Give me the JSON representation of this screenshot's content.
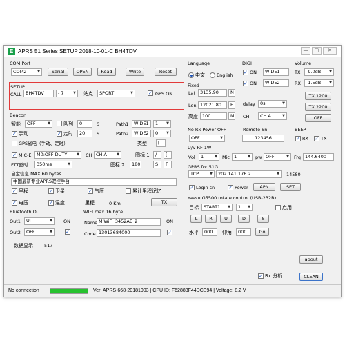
{
  "window": {
    "title": "APRS   51 Series SETUP 2018-10-01-C BH4TDV",
    "logo": "E",
    "minimize": "—",
    "maximize": "▢",
    "close": "✕"
  },
  "com_port": {
    "label": "COM Port",
    "port": "COM2",
    "serial_label": "Serial",
    "open_label": "OPEN",
    "read_label": "Read",
    "write_label": "Write",
    "reset_label": "Reset"
  },
  "setup": {
    "label": "SETUP",
    "call_label": "CALL",
    "call_value": "BH4TDV",
    "ssid": "- 7",
    "station_label": "站点",
    "station_value": "SPORT",
    "gps_on_label": "GPS ON",
    "gps_on_checked": true
  },
  "beacon": {
    "label": "Beacon",
    "smart_label": "智能",
    "smart_value": "OFF",
    "queue_label": "队列",
    "queue_checked": false,
    "queue_value": "0",
    "queue_unit": "S",
    "path1_label": "Path1",
    "path1_value": "WIDE1",
    "path1_n": "1",
    "manual_label": "手动",
    "manual_checked": true,
    "timer_label": "定时",
    "timer_checked": true,
    "timer_value": "20",
    "timer_unit": "S",
    "path2_label": "Path2",
    "path2_value": "WIDE2",
    "path2_n": "0",
    "gps_save_label": "GPS省电（手动、定时）",
    "gps_save_checked": false,
    "type_label": "类型",
    "type_value": "[",
    "mice_label": "MIC-E",
    "mice_checked": true,
    "mice_value": "M0:OFF DUTY",
    "ch_label": "CH",
    "ch_value": "CH A",
    "icon1_label": "图标 1",
    "icon1_a": "/",
    "icon1_b": "[",
    "ftt_label": "FTT延时",
    "ftt_value": "350ms",
    "icon2_label": "图标 2",
    "icon2_val": "180",
    "icon2_a": "S",
    "icon2_b": "F"
  },
  "custom_info": {
    "label": "自定信息 MAX 60 bytes",
    "value": "中国最新专业APRS双控手台"
  },
  "options": {
    "mileage_label": "里程",
    "mileage_checked": true,
    "satellite_label": "卫星",
    "satellite_checked": true,
    "pressure_label": "气压",
    "pressure_checked": true,
    "total_mileage_label": "累计里程记忆",
    "total_mileage_checked": false,
    "voltage_label": "电压",
    "voltage_checked": true,
    "temperature_label": "温度",
    "temperature_checked": true,
    "mileage2_label": "里程",
    "mileage2_value": "0 Km",
    "tx_label": "TX"
  },
  "bluetooth": {
    "label": "Bluetooth OUT",
    "out1_label": "Out1",
    "out1_value": "UI",
    "out1_on": "ON",
    "out2_label": "Out2",
    "out2_value": "OFF",
    "out2_checked": true
  },
  "wifi": {
    "label": "WIFI max 16 byte",
    "name_label": "Name",
    "name_value": "MiWiFi_3452AE_2",
    "on_label": "ON",
    "code_label": "Code",
    "code_value": "13013684000",
    "code_checked": true
  },
  "data_display": {
    "label": "数据显示",
    "value": "517"
  },
  "language": {
    "label": "Language",
    "chinese_label": "中文",
    "chinese_selected": true,
    "english_label": "English",
    "english_selected": false
  },
  "fixed": {
    "label": "Fixed",
    "lat_label": "Lat",
    "lat_value": "3135.90",
    "lat_dir": "N",
    "lon_label": "Lon",
    "lon_value": "12021.80",
    "lon_dir": "E",
    "alt_label": "高度",
    "alt_value": "100",
    "alt_unit": "M"
  },
  "digi": {
    "label": "DIGI",
    "on1_label": "ON",
    "on1_checked": true,
    "wide1_value": "WIDE1",
    "on2_label": "ON",
    "on2_checked": true,
    "wide2_value": "WIDE2",
    "delay_label": "delay",
    "delay_value": "0s",
    "ch_label": "CH",
    "ch_value": "CH A"
  },
  "volume": {
    "label": "Volume",
    "tx_label": "TX",
    "tx_value": "-9.0dB",
    "rx_label": "RX",
    "rx_value": "-1.5dB",
    "tx1200_label": "TX 1200",
    "tx2200_label": "TX 2200",
    "off_label": "OFF"
  },
  "no_rx_power": {
    "label": "No Rx Power OFF",
    "value": "OFF"
  },
  "remote_sn": {
    "label": "Remote Sn",
    "value": "123456"
  },
  "beep": {
    "label": "BEEP",
    "rx_label": "RX",
    "rx_checked": true,
    "tx_label": "TX",
    "tx_checked": true
  },
  "uv_rf": {
    "label": "U/V RF 1W",
    "vol_label": "Vol",
    "vol_value": "1",
    "mic_label": "Mic",
    "mic_value": "1",
    "pw_label": "pw",
    "pw_value": "OFF",
    "frq_label": "Frq",
    "frq_value": "144.6400"
  },
  "gprs": {
    "label": "GPRS for 51G",
    "proto_value": "TCP",
    "ip_value": "202.141.176.2",
    "port_value": "14580",
    "login_label": "Login sn",
    "login_checked": true,
    "power_label": "Power",
    "power_checked": true,
    "apn_label": "APN",
    "set_label": "SET"
  },
  "yaesu": {
    "label": "Yaesu G5500 rotate control  (USB-232B)",
    "target_label": "目标",
    "target_value": "START1",
    "target_n": "1",
    "enable_label": "启用",
    "enable_checked": false,
    "btn_l": "L",
    "btn_r": "R",
    "btn_u": "U",
    "btn_d": "D",
    "btn_s": "S",
    "h_label": "水平",
    "h_value": "000",
    "v_label": "仰角",
    "v_value": "000",
    "go_label": "Go"
  },
  "bottom": {
    "about_label": "about",
    "rx_analysis_label": "Rx 分析",
    "rx_analysis_checked": true,
    "clean_label": "CLEAN"
  },
  "status": {
    "connection": "No connection",
    "progress": 1.0,
    "info": "Ver: APRS-668-20181003 | CPU ID: F62883F44DCE94 | Voltage: 8.2 V"
  },
  "colors": {
    "highlight": "#e23a3a",
    "progress": "#27c22f",
    "logo": "#1aa04a"
  }
}
